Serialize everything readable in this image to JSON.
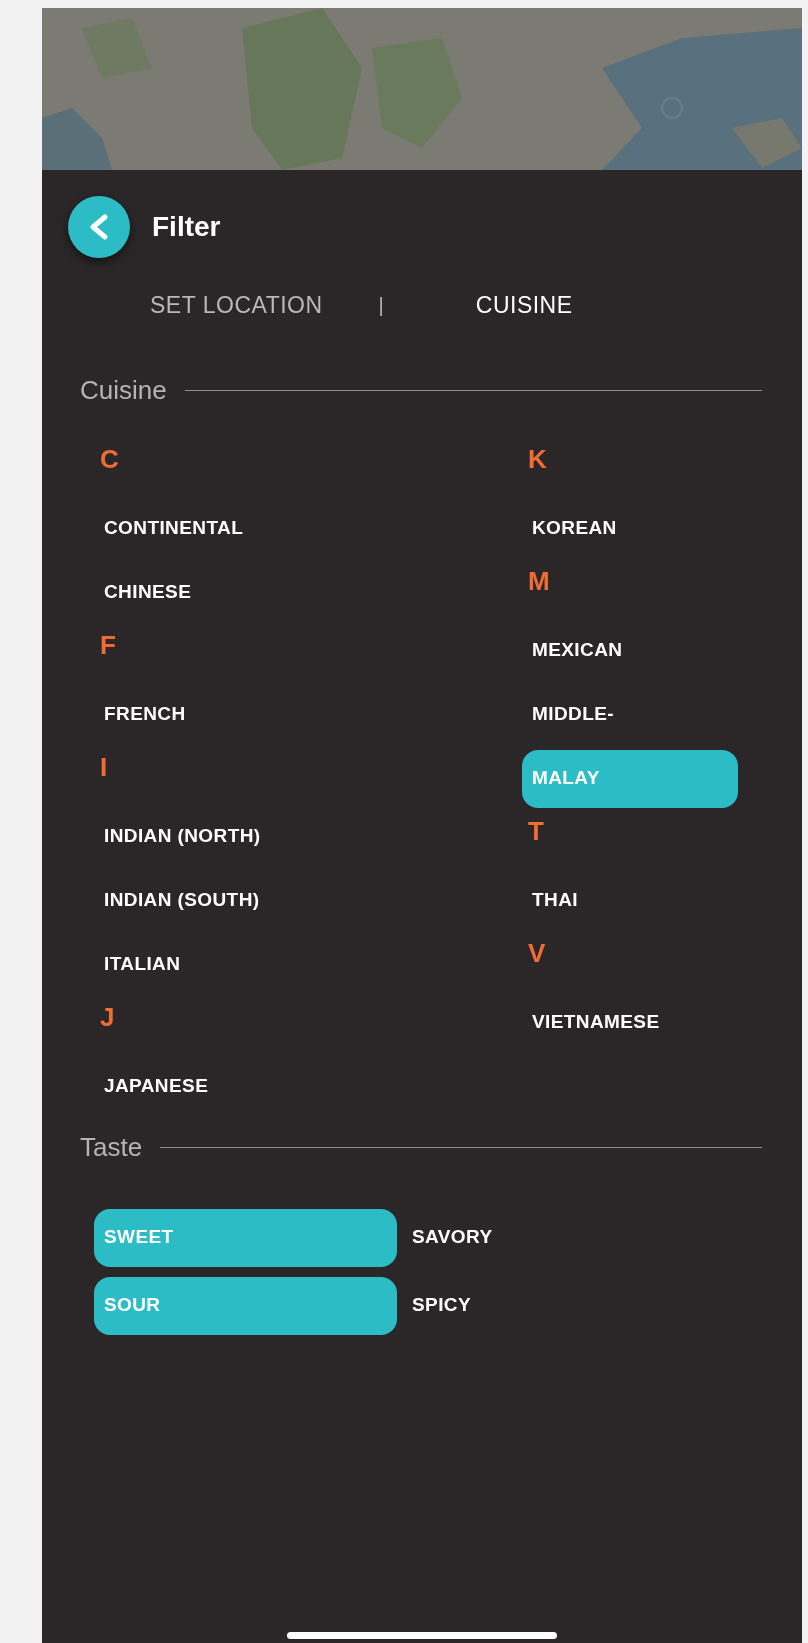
{
  "header": {
    "title": "Filter"
  },
  "tabs": [
    {
      "label": "SET LOCATION",
      "selected": false
    },
    {
      "label": "CUISINE",
      "selected": true
    }
  ],
  "tab_separator": "|",
  "cuisine": {
    "title": "Cuisine",
    "columns": [
      [
        {
          "kind": "letter",
          "label": "C"
        },
        {
          "kind": "option",
          "label": "CONTINENTAL",
          "selected": false
        },
        {
          "kind": "option",
          "label": "CHINESE",
          "selected": false
        },
        {
          "kind": "letter",
          "label": "F"
        },
        {
          "kind": "option",
          "label": "FRENCH",
          "selected": false
        },
        {
          "kind": "letter",
          "label": "I"
        },
        {
          "kind": "option",
          "label": "INDIAN (NORTH)",
          "selected": false
        },
        {
          "kind": "option",
          "label": "INDIAN (SOUTH)",
          "selected": false
        },
        {
          "kind": "option",
          "label": "ITALIAN",
          "selected": false
        },
        {
          "kind": "letter",
          "label": "J"
        },
        {
          "kind": "option",
          "label": "JAPANESE",
          "selected": false
        }
      ],
      [
        {
          "kind": "letter",
          "label": "K"
        },
        {
          "kind": "option",
          "label": "KOREAN",
          "selected": false
        },
        {
          "kind": "letter",
          "label": "M"
        },
        {
          "kind": "option",
          "label": "MEXICAN",
          "selected": false
        },
        {
          "kind": "option",
          "label": "MIDDLE-",
          "selected": false
        },
        {
          "kind": "option",
          "label": "MALAY",
          "selected": true
        },
        {
          "kind": "letter",
          "label": "T"
        },
        {
          "kind": "option",
          "label": "THAI",
          "selected": false
        },
        {
          "kind": "letter",
          "label": "V"
        },
        {
          "kind": "option",
          "label": "VIETNAMESE",
          "selected": false
        }
      ]
    ]
  },
  "taste": {
    "title": "Taste",
    "options": [
      {
        "label": "SWEET",
        "selected": true
      },
      {
        "label": "SAVORY",
        "selected": false
      },
      {
        "label": "SOUR",
        "selected": true
      },
      {
        "label": "SPICY",
        "selected": false
      }
    ]
  }
}
